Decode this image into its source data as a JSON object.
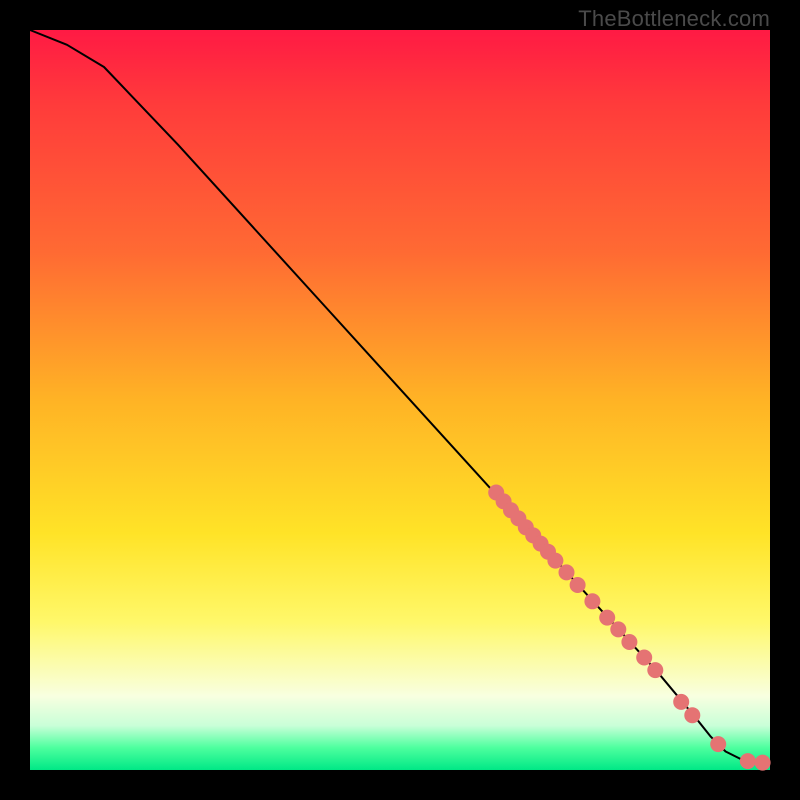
{
  "watermark": "TheBottleneck.com",
  "chart_data": {
    "type": "line",
    "title": "",
    "xlabel": "",
    "ylabel": "",
    "xlim": [
      0,
      100
    ],
    "ylim": [
      0,
      100
    ],
    "curve": {
      "x": [
        0,
        5,
        10,
        20,
        30,
        40,
        50,
        60,
        65,
        70,
        75,
        80,
        85,
        90,
        92,
        94,
        96,
        98,
        100
      ],
      "y": [
        100,
        98,
        95,
        84.5,
        73.5,
        62.5,
        51.5,
        40.5,
        35,
        29.5,
        24,
        18.5,
        13,
        7,
        4.5,
        2.5,
        1.5,
        1,
        1
      ]
    },
    "scatter": {
      "color": "#e57373",
      "radius_px": 8,
      "x": [
        63,
        64,
        65,
        66,
        67,
        68,
        69,
        70,
        71,
        72.5,
        74,
        76,
        78,
        79.5,
        81,
        83,
        84.5,
        88,
        89.5,
        93,
        97,
        99
      ],
      "y": [
        37.5,
        36.3,
        35.1,
        34.0,
        32.8,
        31.7,
        30.6,
        29.5,
        28.3,
        26.7,
        25.0,
        22.8,
        20.6,
        19.0,
        17.3,
        15.2,
        13.5,
        9.2,
        7.4,
        3.5,
        1.2,
        1.0
      ]
    }
  }
}
